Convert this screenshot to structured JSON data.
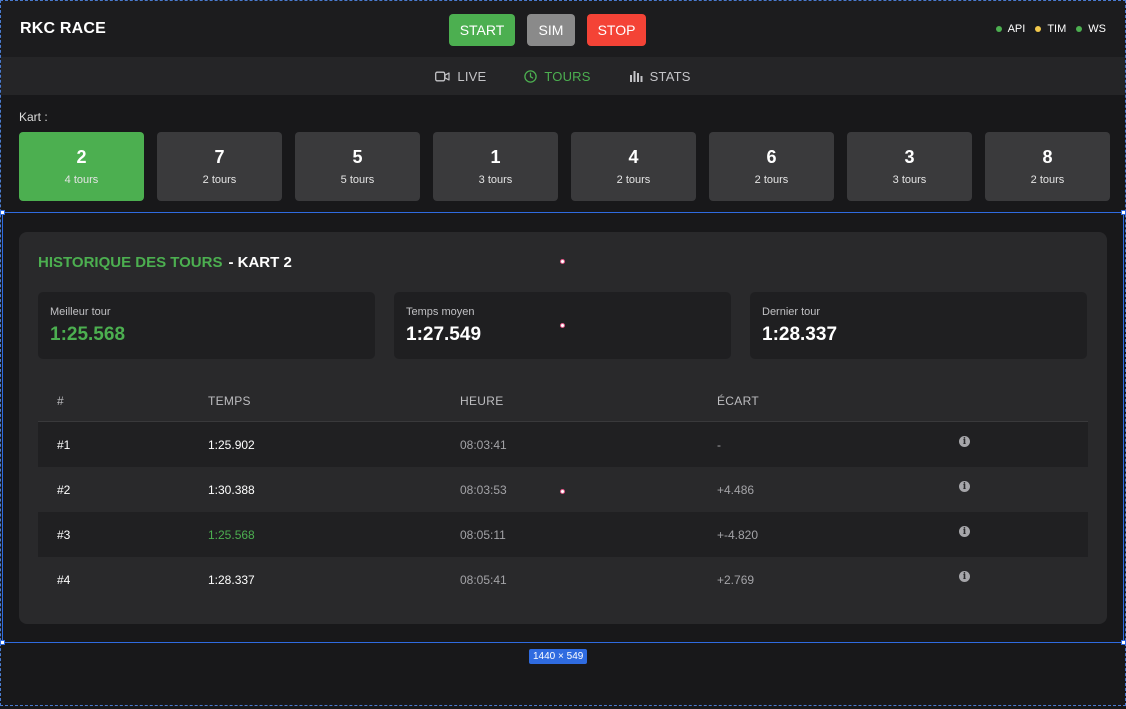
{
  "app": {
    "title": "RKC RACE"
  },
  "controls": {
    "start": "START",
    "sim": "SIM",
    "stop": "STOP"
  },
  "status": [
    {
      "label": "API",
      "color": "#4caf50"
    },
    {
      "label": "TIM",
      "color": "#f2c94c"
    },
    {
      "label": "WS",
      "color": "#4caf50"
    }
  ],
  "tabs": [
    {
      "label": "LIVE",
      "icon": "video-icon",
      "active": false
    },
    {
      "label": "TOURS",
      "icon": "clock-icon",
      "active": true
    },
    {
      "label": "STATS",
      "icon": "bar-chart-icon",
      "active": false
    }
  ],
  "kart_selector": {
    "label": "Kart :",
    "karts": [
      {
        "number": "2",
        "laps": "4 tours",
        "active": true
      },
      {
        "number": "7",
        "laps": "2 tours",
        "active": false
      },
      {
        "number": "5",
        "laps": "5 tours",
        "active": false
      },
      {
        "number": "1",
        "laps": "3 tours",
        "active": false
      },
      {
        "number": "4",
        "laps": "2 tours",
        "active": false
      },
      {
        "number": "6",
        "laps": "2 tours",
        "active": false
      },
      {
        "number": "3",
        "laps": "3 tours",
        "active": false
      },
      {
        "number": "8",
        "laps": "2 tours",
        "active": false
      }
    ]
  },
  "history": {
    "title": "HISTORIQUE DES TOURS",
    "subtitle": "- KART 2",
    "stats": {
      "best": {
        "label": "Meilleur tour",
        "value": "1:25.568"
      },
      "avg": {
        "label": "Temps moyen",
        "value": "1:27.549"
      },
      "last": {
        "label": "Dernier tour",
        "value": "1:28.337"
      }
    },
    "columns": [
      "#",
      "TEMPS",
      "HEURE",
      "ÉCART"
    ],
    "rows": [
      {
        "num": "#1",
        "time": "1:25.902",
        "clock": "08:03:41",
        "gap": "-"
      },
      {
        "num": "#2",
        "time": "1:30.388",
        "clock": "08:03:53",
        "gap": "+4.486"
      },
      {
        "num": "#3",
        "time": "1:25.568",
        "clock": "08:05:11",
        "gap": "+-4.820"
      },
      {
        "num": "#4",
        "time": "1:28.337",
        "clock": "08:05:41",
        "gap": "+2.769"
      }
    ]
  },
  "overlay": {
    "size_label": "1440 × 549"
  },
  "colors": {
    "accent": "#4caf50",
    "danger": "#f44336",
    "warning": "#f2c94c",
    "selection": "#2f6be0"
  }
}
